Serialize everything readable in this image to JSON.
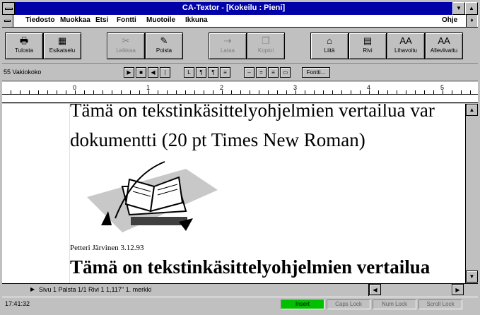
{
  "window": {
    "title": "CA-Textor - [Kokeilu : Pieni]"
  },
  "menu": {
    "items": [
      {
        "label": "Tiedosto"
      },
      {
        "label": "Muokkaa"
      },
      {
        "label": "Etsi"
      },
      {
        "label": "Fontti"
      },
      {
        "label": "Muotoile"
      },
      {
        "label": "Ikkuna"
      }
    ],
    "help": "Ohje"
  },
  "toolbar": {
    "buttons": [
      {
        "label": "Tulosta",
        "icon": "printer-icon",
        "glyph": "🖶",
        "enabled": true
      },
      {
        "label": "Esikatselu",
        "icon": "preview-icon",
        "glyph": "▦",
        "enabled": true
      },
      {
        "label": "Leikkaa",
        "icon": "scissors-icon",
        "glyph": "✂",
        "enabled": false
      },
      {
        "label": "Poista",
        "icon": "eraser-icon",
        "glyph": "✎",
        "enabled": true
      },
      {
        "label": "Lataa",
        "icon": "load-icon",
        "glyph": "⇢",
        "enabled": false
      },
      {
        "label": "Kopioi",
        "icon": "copy-icon",
        "glyph": "❐",
        "enabled": false
      },
      {
        "label": "Liitä",
        "icon": "paste-icon",
        "glyph": "⌂",
        "enabled": true
      },
      {
        "label": "Rivi",
        "icon": "row-icon",
        "glyph": "▤",
        "enabled": true
      },
      {
        "label": "Lihavoitu",
        "icon": "bold-aa-icon",
        "glyph": "AA",
        "enabled": true
      },
      {
        "label": "Alleviivattu",
        "icon": "underline-aa-icon",
        "glyph": "AA",
        "enabled": true
      }
    ]
  },
  "format": {
    "zoom": "55 Vakiokoko",
    "font_button": "Fontti..."
  },
  "ruler": {
    "numbers": [
      "0",
      "1",
      "2",
      "3",
      "4",
      "5"
    ]
  },
  "document": {
    "line1": "Tämä on tekstinkäsittelyohjelmien vertailua var",
    "line2": "dokumentti (20 pt Times New Roman)",
    "author": "Petteri Järvinen 3.12.93",
    "bold_line": "Tämä on tekstinkäsittelyohjelmien vertailua"
  },
  "pagebar": {
    "status": "Sivu 1 Palsta 1/1 Rivi 1 1,117\" 1. merkki"
  },
  "statusbar": {
    "time": "17:41:32",
    "indicators": [
      {
        "label": "Insert",
        "active": true
      },
      {
        "label": "Caps Lock",
        "active": false
      },
      {
        "label": "Num Lock",
        "active": false
      },
      {
        "label": "Scroll Lock",
        "active": false
      }
    ]
  },
  "colors": {
    "titlebar": "#0000a8",
    "face": "#c0c0c0",
    "insert_on": "#00c000"
  }
}
